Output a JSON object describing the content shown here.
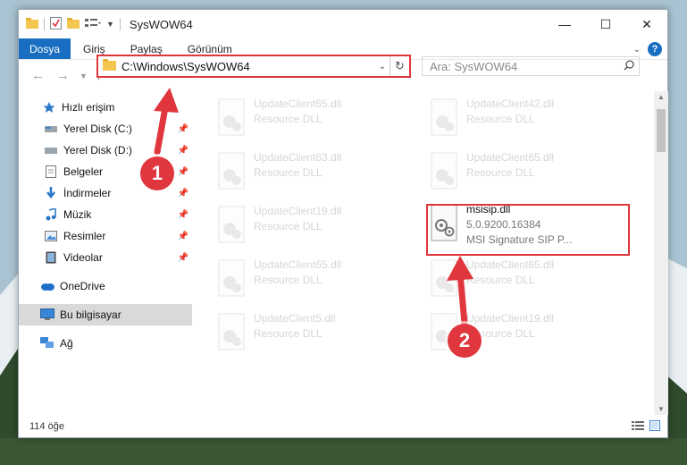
{
  "window": {
    "title": "SysWOW64"
  },
  "window_controls": {
    "minimize": "—",
    "maximize": "☐",
    "close": "✕"
  },
  "ribbon": {
    "tabs": [
      "Dosya",
      "Giriş",
      "Paylaş",
      "Görünüm"
    ]
  },
  "address": {
    "path": "C:\\Windows\\SysWOW64"
  },
  "search": {
    "placeholder": "Ara: SysWOW64"
  },
  "nav": {
    "quick_access": "Hızlı erişim",
    "items": [
      {
        "label": "Yerel Disk (C:)",
        "icon": "drive-icon"
      },
      {
        "label": "Yerel Disk (D:)",
        "icon": "drive-icon"
      },
      {
        "label": "Belgeler",
        "icon": "documents-icon"
      },
      {
        "label": "İndirmeler",
        "icon": "downloads-icon"
      },
      {
        "label": "Müzik",
        "icon": "music-icon"
      },
      {
        "label": "Resimler",
        "icon": "pictures-icon"
      },
      {
        "label": "Videolar",
        "icon": "videos-icon"
      }
    ],
    "onedrive": "OneDrive",
    "this_pc": "Bu bilgisayar",
    "network": "Ağ"
  },
  "files": [
    {
      "name": "UpdateClient65.dll",
      "desc": "Resource DLL"
    },
    {
      "name": "UpdateClient42.dll",
      "desc": "Resource DLL"
    },
    {
      "name": "UpdateClient63.dll",
      "desc": "Resource DLL"
    },
    {
      "name": "UpdateClient65.dll",
      "desc": "Resource DLL"
    },
    {
      "name": "UpdateClient19.dll",
      "desc": "Resource DLL"
    },
    {
      "name": "msisip.dll",
      "version": "5.0.9200.16384",
      "desc": "MSI Signature SIP P..."
    },
    {
      "name": "UpdateClient65.dll",
      "desc": "Resource DLL"
    },
    {
      "name": "UpdateClient65.dll",
      "desc": "Resource DLL"
    },
    {
      "name": "UpdateClient5.dll",
      "desc": "Resource DLL"
    },
    {
      "name": "UpdateClient19.dll",
      "desc": "Resource DLL"
    }
  ],
  "status": {
    "count": "114 öğe"
  },
  "annotations": {
    "step1": "1",
    "step2": "2"
  },
  "colors": {
    "accent": "#1a6ec2",
    "highlight": "#e0363d"
  }
}
